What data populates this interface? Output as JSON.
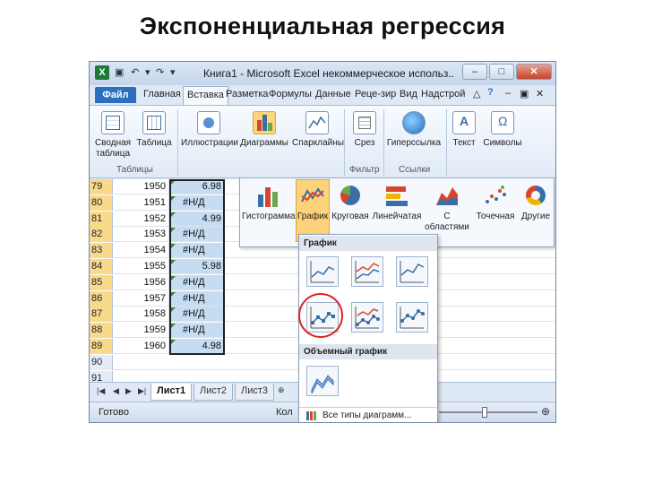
{
  "slide": {
    "title": "Экспоненциальная регрессия"
  },
  "window": {
    "title": "Книга1 - Microsoft Excel некоммерческое использ..",
    "logo": "X",
    "minimize": "–",
    "maximize": "□",
    "close": "✕"
  },
  "tabs": [
    "Файл",
    "Главная",
    "Вставка",
    "Разметка",
    "Формулы",
    "Данные",
    "Реце-зир",
    "Вид",
    "Надстрой"
  ],
  "ribbon": {
    "pivot_label": "Сводная таблица",
    "table_label": "Таблица",
    "illustrations_label": "Иллюстрации",
    "charts_label": "Диаграммы",
    "sparklines_label": "Спарклайны",
    "slicer_label": "Срез",
    "hyperlink_label": "Гиперссылка",
    "text_label": "Текст",
    "symbols_label": "Символы",
    "group_tables": "Таблицы",
    "group_filter": "Фильтр",
    "group_links": "Ссылки"
  },
  "rows": [
    {
      "num": "79",
      "year": "1950",
      "value": "6.98"
    },
    {
      "num": "80",
      "year": "1951",
      "value": "#Н/Д"
    },
    {
      "num": "81",
      "year": "1952",
      "value": "4.99"
    },
    {
      "num": "82",
      "year": "1953",
      "value": "#Н/Д"
    },
    {
      "num": "83",
      "year": "1954",
      "value": "#Н/Д"
    },
    {
      "num": "84",
      "year": "1955",
      "value": "5.98"
    },
    {
      "num": "85",
      "year": "1956",
      "value": "#Н/Д"
    },
    {
      "num": "86",
      "year": "1957",
      "value": "#Н/Д"
    },
    {
      "num": "87",
      "year": "1958",
      "value": "#Н/Д"
    },
    {
      "num": "88",
      "year": "1959",
      "value": "#Н/Д"
    },
    {
      "num": "89",
      "year": "1960",
      "value": "4.98"
    },
    {
      "num": "90",
      "year": "",
      "value": ""
    },
    {
      "num": "91",
      "year": "",
      "value": ""
    }
  ],
  "charts_panel": {
    "histogram": "Гистограмма",
    "line": "График",
    "pie": "Круговая",
    "bar": "Линейчатая",
    "area": "С областями",
    "scatter": "Точечная",
    "other": "Другие"
  },
  "dropdown": {
    "line_header": "График",
    "line3d_header": "Объемный график",
    "all_types": "Все типы диаграмм..."
  },
  "sheets": [
    "Лист1",
    "Лист2",
    "Лист3"
  ],
  "status": {
    "ready": "Готово",
    "count": "Кол"
  },
  "colors": {
    "highlight": "#fcd27a",
    "selection": "#c6dcf2",
    "circle": "#e02020",
    "excel_green": "#1f7a3a"
  }
}
